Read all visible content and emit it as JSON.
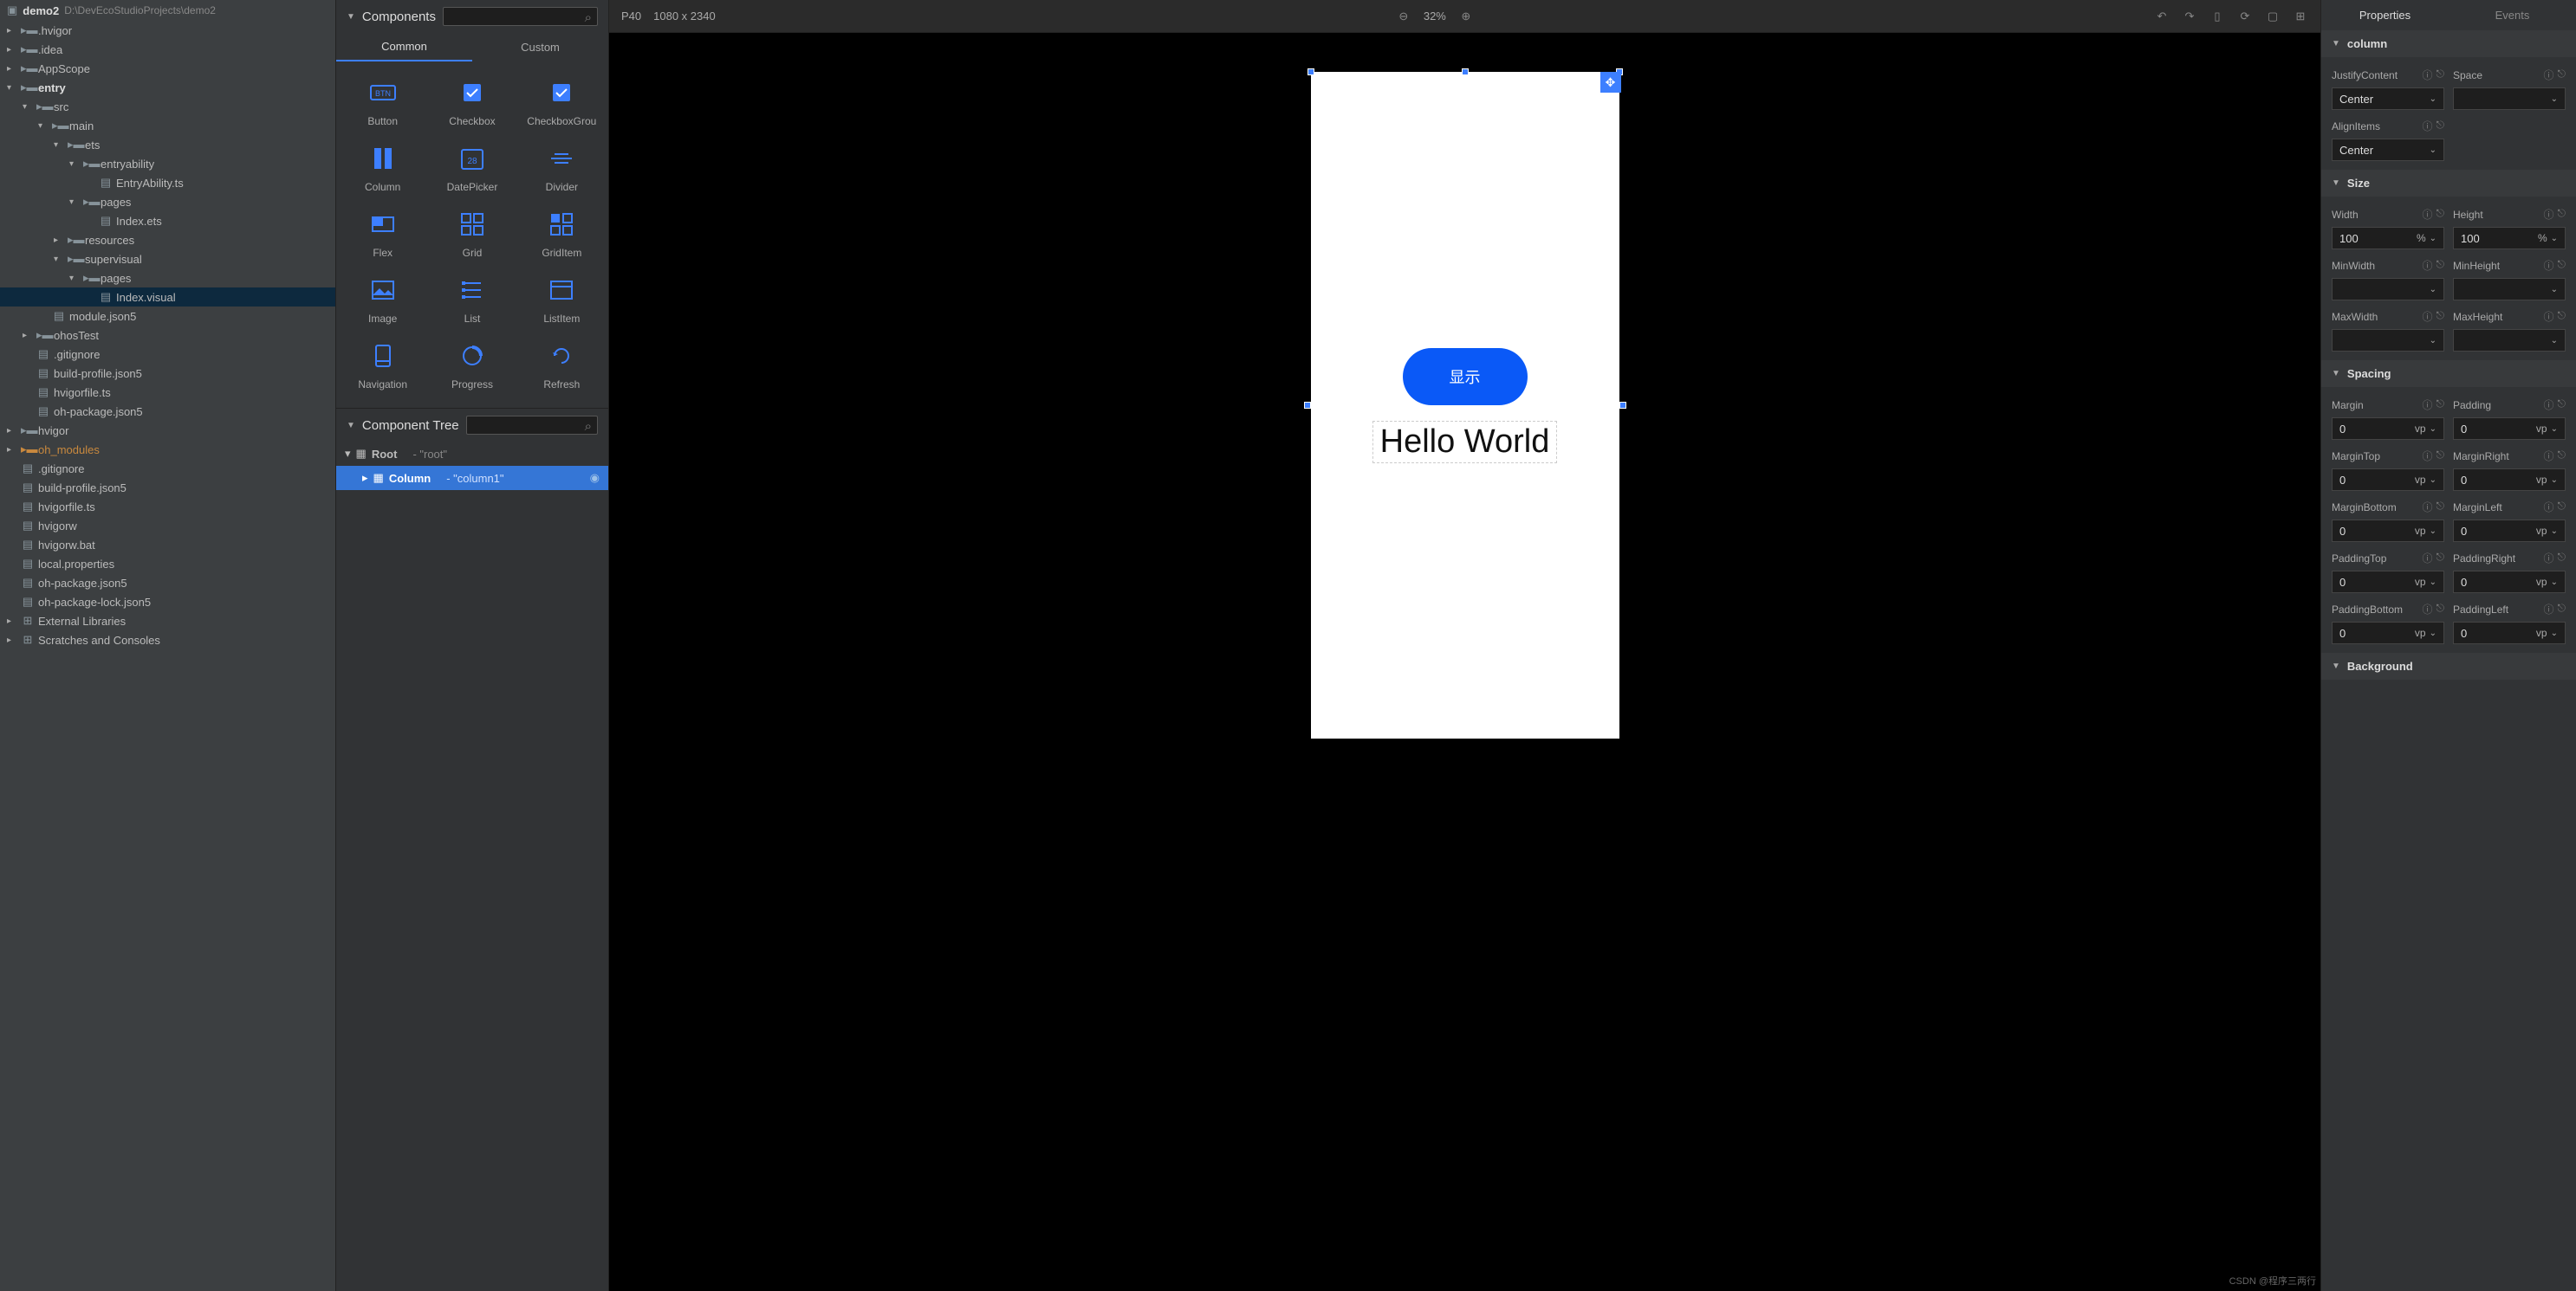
{
  "project": {
    "name": "demo2",
    "path": "D:\\DevEcoStudioProjects\\demo2"
  },
  "tree": [
    {
      "indent": 0,
      "arrow": ">",
      "icon": "folder",
      "label": ".hvigor"
    },
    {
      "indent": 0,
      "arrow": ">",
      "icon": "folder",
      "label": ".idea"
    },
    {
      "indent": 0,
      "arrow": ">",
      "icon": "folder",
      "label": "AppScope"
    },
    {
      "indent": 0,
      "arrow": "v",
      "icon": "folder",
      "label": "entry",
      "bold": true
    },
    {
      "indent": 1,
      "arrow": "v",
      "icon": "folder",
      "label": "src"
    },
    {
      "indent": 2,
      "arrow": "v",
      "icon": "folder",
      "label": "main"
    },
    {
      "indent": 3,
      "arrow": "v",
      "icon": "folder",
      "label": "ets"
    },
    {
      "indent": 4,
      "arrow": "v",
      "icon": "folder",
      "label": "entryability"
    },
    {
      "indent": 5,
      "arrow": "",
      "icon": "ts",
      "label": "EntryAbility.ts"
    },
    {
      "indent": 4,
      "arrow": "v",
      "icon": "folder",
      "label": "pages"
    },
    {
      "indent": 5,
      "arrow": "",
      "icon": "ets",
      "label": "Index.ets"
    },
    {
      "indent": 3,
      "arrow": ">",
      "icon": "folder",
      "label": "resources"
    },
    {
      "indent": 3,
      "arrow": "v",
      "icon": "folder",
      "label": "supervisual"
    },
    {
      "indent": 4,
      "arrow": "v",
      "icon": "folder",
      "label": "pages"
    },
    {
      "indent": 5,
      "arrow": "",
      "icon": "visual",
      "label": "Index.visual",
      "selected": true
    },
    {
      "indent": 2,
      "arrow": "",
      "icon": "json",
      "label": "module.json5"
    },
    {
      "indent": 1,
      "arrow": ">",
      "icon": "folder",
      "label": "ohosTest"
    },
    {
      "indent": 1,
      "arrow": "",
      "icon": "file",
      "label": ".gitignore"
    },
    {
      "indent": 1,
      "arrow": "",
      "icon": "json",
      "label": "build-profile.json5"
    },
    {
      "indent": 1,
      "arrow": "",
      "icon": "ts",
      "label": "hvigorfile.ts"
    },
    {
      "indent": 1,
      "arrow": "",
      "icon": "json",
      "label": "oh-package.json5"
    },
    {
      "indent": 0,
      "arrow": ">",
      "icon": "folder",
      "label": "hvigor"
    },
    {
      "indent": 0,
      "arrow": ">",
      "icon": "folder-orange",
      "label": "oh_modules",
      "orange": true
    },
    {
      "indent": 0,
      "arrow": "",
      "icon": "file",
      "label": ".gitignore"
    },
    {
      "indent": 0,
      "arrow": "",
      "icon": "json",
      "label": "build-profile.json5"
    },
    {
      "indent": 0,
      "arrow": "",
      "icon": "ts",
      "label": "hvigorfile.ts"
    },
    {
      "indent": 0,
      "arrow": "",
      "icon": "file",
      "label": "hvigorw"
    },
    {
      "indent": 0,
      "arrow": "",
      "icon": "file",
      "label": "hvigorw.bat"
    },
    {
      "indent": 0,
      "arrow": "",
      "icon": "file",
      "label": "local.properties"
    },
    {
      "indent": 0,
      "arrow": "",
      "icon": "json",
      "label": "oh-package.json5"
    },
    {
      "indent": 0,
      "arrow": "",
      "icon": "json",
      "label": "oh-package-lock.json5"
    }
  ],
  "tree_footer": [
    "External Libraries",
    "Scratches and Consoles"
  ],
  "components": {
    "title": "Components",
    "tabs": [
      "Common",
      "Custom"
    ],
    "active_tab": 0,
    "items": [
      "Button",
      "Checkbox",
      "CheckboxGrou",
      "Column",
      "DatePicker",
      "Divider",
      "Flex",
      "Grid",
      "GridItem",
      "Image",
      "List",
      "ListItem",
      "Navigation",
      "Progress",
      "Refresh"
    ]
  },
  "component_tree": {
    "title": "Component Tree",
    "rows": [
      {
        "name": "Root",
        "desc": "- \"root\"",
        "selected": false
      },
      {
        "name": "Column",
        "desc": "- \"column1\"",
        "selected": true
      }
    ]
  },
  "canvas": {
    "device": "P40",
    "resolution": "1080 x 2340",
    "zoom": "32%",
    "button_text": "显示",
    "hello_text": "Hello World"
  },
  "properties": {
    "tabs": [
      "Properties",
      "Events"
    ],
    "active_tab": 0,
    "sections": [
      {
        "title": "column",
        "rows": [
          {
            "label": "JustifyContent",
            "value": "Center",
            "type": "select",
            "icons": true
          },
          {
            "label": "Space",
            "value": "",
            "type": "select",
            "icons": true
          },
          {
            "label": "AlignItems",
            "value": "Center",
            "type": "select",
            "icons": true,
            "span": 1
          }
        ]
      },
      {
        "title": "Size",
        "rows": [
          {
            "label": "Width",
            "value": "100",
            "unit": "%",
            "icons": true
          },
          {
            "label": "Height",
            "value": "100",
            "unit": "%",
            "icons": true
          },
          {
            "label": "MinWidth",
            "value": "",
            "unit": "",
            "icons": true
          },
          {
            "label": "MinHeight",
            "value": "",
            "unit": "",
            "icons": true
          },
          {
            "label": "MaxWidth",
            "value": "",
            "unit": "",
            "icons": true
          },
          {
            "label": "MaxHeight",
            "value": "",
            "unit": "",
            "icons": true
          }
        ]
      },
      {
        "title": "Spacing",
        "rows": [
          {
            "label": "Margin",
            "value": "0",
            "unit": "vp",
            "icons": true
          },
          {
            "label": "Padding",
            "value": "0",
            "unit": "vp",
            "icons": true
          },
          {
            "label": "MarginTop",
            "value": "0",
            "unit": "vp",
            "icons": true
          },
          {
            "label": "MarginRight",
            "value": "0",
            "unit": "vp",
            "icons": true
          },
          {
            "label": "MarginBottom",
            "value": "0",
            "unit": "vp",
            "icons": true
          },
          {
            "label": "MarginLeft",
            "value": "0",
            "unit": "vp",
            "icons": true
          },
          {
            "label": "PaddingTop",
            "value": "0",
            "unit": "vp",
            "icons": true
          },
          {
            "label": "PaddingRight",
            "value": "0",
            "unit": "vp",
            "icons": true
          },
          {
            "label": "PaddingBottom",
            "value": "0",
            "unit": "vp",
            "icons": true
          },
          {
            "label": "PaddingLeft",
            "value": "0",
            "unit": "vp",
            "icons": true
          }
        ]
      },
      {
        "title": "Background",
        "rows": []
      }
    ]
  },
  "watermark": "CSDN @程序三两行"
}
